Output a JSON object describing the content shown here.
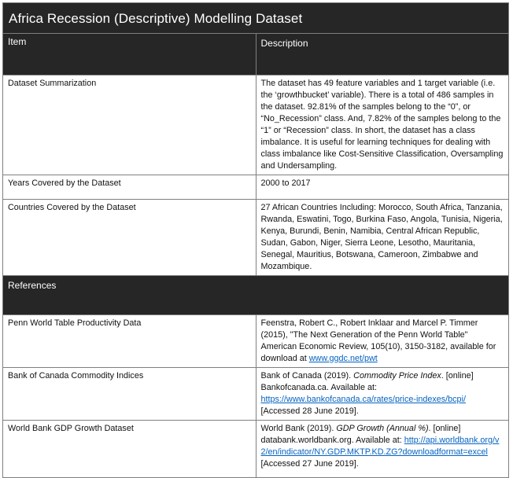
{
  "title": "Africa Recession (Descriptive) Modelling Dataset",
  "header": {
    "item": "Item",
    "description": "Description"
  },
  "rows": [
    {
      "item": "Dataset Summarization",
      "description": "The dataset has 49 feature variables and 1 target variable (i.e. the ‘growthbucket’ variable). There is a total of 486 samples in the dataset. 92.81% of the samples belong to the “0”, or “No_Recession” class. And, 7.82% of the samples belong to the “1” or “Recession” class. In short, the dataset has a class imbalance. It is useful for learning techniques for dealing with class imbalance like Cost-Sensitive Classification, Oversampling and Undersampling."
    },
    {
      "item": "Years Covered by the Dataset",
      "description": "2000 to 2017"
    },
    {
      "item": "Countries Covered by the Dataset",
      "description": "27 African Countries Including: Morocco, South Africa, Tanzania, Rwanda, Eswatini, Togo, Burkina Faso, Angola, Tunisia, Nigeria, Kenya, Burundi, Benin, Namibia, Central African Republic, Sudan, Gabon, Niger, Sierra Leone, Lesotho, Mauritania, Senegal, Mauritius, Botswana, Cameroon, Zimbabwe and  Mozambique."
    }
  ],
  "references_label": "References",
  "references": [
    {
      "item": "Penn World Table Productivity Data",
      "text": "Feenstra, Robert C., Robert Inklaar and Marcel P. Timmer (2015), \"The Next Generation of the Penn World Table\" American Economic Review, 105(10), 3150-3182, available for download at ",
      "link": "www.ggdc.net/pwt"
    },
    {
      "item": "Bank of Canada Commodity Indices",
      "before": "Bank of Canada (2019). ",
      "italic": "Commodity Price Index",
      "after": ". [online] Bankofcanada.ca. Available at: ",
      "link": "https://www.bankofcanada.ca/rates/price-indexes/bcpi/",
      "tail": "  [Accessed 28 June 2019]."
    },
    {
      "item": "World Bank GDP Growth Dataset",
      "before": "World Bank (2019). ",
      "italic": "GDP Growth (Annual %)",
      "after": ". [online] databank.worldbank.org. Available at: ",
      "link": "http://api.worldbank.org/v2/en/indicator/NY.GDP.MKTP.KD.ZG?downloadformat=excel",
      "tail": " [Accessed 27 June 2019]."
    }
  ]
}
